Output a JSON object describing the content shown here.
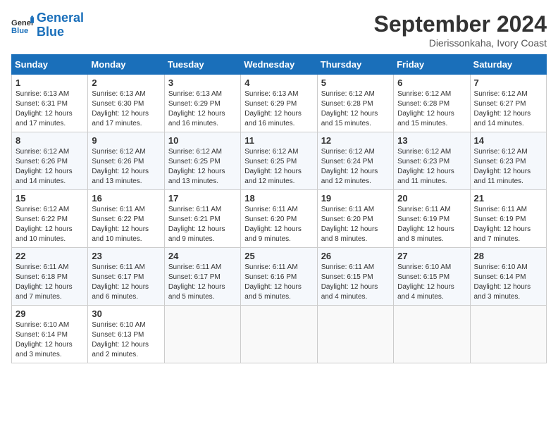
{
  "header": {
    "logo_line1": "General",
    "logo_line2": "Blue",
    "month": "September 2024",
    "location": "Dierissonkaha, Ivory Coast"
  },
  "days_of_week": [
    "Sunday",
    "Monday",
    "Tuesday",
    "Wednesday",
    "Thursday",
    "Friday",
    "Saturday"
  ],
  "weeks": [
    [
      {
        "day": "1",
        "info": "Sunrise: 6:13 AM\nSunset: 6:31 PM\nDaylight: 12 hours\nand 17 minutes."
      },
      {
        "day": "2",
        "info": "Sunrise: 6:13 AM\nSunset: 6:30 PM\nDaylight: 12 hours\nand 17 minutes."
      },
      {
        "day": "3",
        "info": "Sunrise: 6:13 AM\nSunset: 6:29 PM\nDaylight: 12 hours\nand 16 minutes."
      },
      {
        "day": "4",
        "info": "Sunrise: 6:13 AM\nSunset: 6:29 PM\nDaylight: 12 hours\nand 16 minutes."
      },
      {
        "day": "5",
        "info": "Sunrise: 6:12 AM\nSunset: 6:28 PM\nDaylight: 12 hours\nand 15 minutes."
      },
      {
        "day": "6",
        "info": "Sunrise: 6:12 AM\nSunset: 6:28 PM\nDaylight: 12 hours\nand 15 minutes."
      },
      {
        "day": "7",
        "info": "Sunrise: 6:12 AM\nSunset: 6:27 PM\nDaylight: 12 hours\nand 14 minutes."
      }
    ],
    [
      {
        "day": "8",
        "info": "Sunrise: 6:12 AM\nSunset: 6:26 PM\nDaylight: 12 hours\nand 14 minutes."
      },
      {
        "day": "9",
        "info": "Sunrise: 6:12 AM\nSunset: 6:26 PM\nDaylight: 12 hours\nand 13 minutes."
      },
      {
        "day": "10",
        "info": "Sunrise: 6:12 AM\nSunset: 6:25 PM\nDaylight: 12 hours\nand 13 minutes."
      },
      {
        "day": "11",
        "info": "Sunrise: 6:12 AM\nSunset: 6:25 PM\nDaylight: 12 hours\nand 12 minutes."
      },
      {
        "day": "12",
        "info": "Sunrise: 6:12 AM\nSunset: 6:24 PM\nDaylight: 12 hours\nand 12 minutes."
      },
      {
        "day": "13",
        "info": "Sunrise: 6:12 AM\nSunset: 6:23 PM\nDaylight: 12 hours\nand 11 minutes."
      },
      {
        "day": "14",
        "info": "Sunrise: 6:12 AM\nSunset: 6:23 PM\nDaylight: 12 hours\nand 11 minutes."
      }
    ],
    [
      {
        "day": "15",
        "info": "Sunrise: 6:12 AM\nSunset: 6:22 PM\nDaylight: 12 hours\nand 10 minutes."
      },
      {
        "day": "16",
        "info": "Sunrise: 6:11 AM\nSunset: 6:22 PM\nDaylight: 12 hours\nand 10 minutes."
      },
      {
        "day": "17",
        "info": "Sunrise: 6:11 AM\nSunset: 6:21 PM\nDaylight: 12 hours\nand 9 minutes."
      },
      {
        "day": "18",
        "info": "Sunrise: 6:11 AM\nSunset: 6:20 PM\nDaylight: 12 hours\nand 9 minutes."
      },
      {
        "day": "19",
        "info": "Sunrise: 6:11 AM\nSunset: 6:20 PM\nDaylight: 12 hours\nand 8 minutes."
      },
      {
        "day": "20",
        "info": "Sunrise: 6:11 AM\nSunset: 6:19 PM\nDaylight: 12 hours\nand 8 minutes."
      },
      {
        "day": "21",
        "info": "Sunrise: 6:11 AM\nSunset: 6:19 PM\nDaylight: 12 hours\nand 7 minutes."
      }
    ],
    [
      {
        "day": "22",
        "info": "Sunrise: 6:11 AM\nSunset: 6:18 PM\nDaylight: 12 hours\nand 7 minutes."
      },
      {
        "day": "23",
        "info": "Sunrise: 6:11 AM\nSunset: 6:17 PM\nDaylight: 12 hours\nand 6 minutes."
      },
      {
        "day": "24",
        "info": "Sunrise: 6:11 AM\nSunset: 6:17 PM\nDaylight: 12 hours\nand 5 minutes."
      },
      {
        "day": "25",
        "info": "Sunrise: 6:11 AM\nSunset: 6:16 PM\nDaylight: 12 hours\nand 5 minutes."
      },
      {
        "day": "26",
        "info": "Sunrise: 6:11 AM\nSunset: 6:15 PM\nDaylight: 12 hours\nand 4 minutes."
      },
      {
        "day": "27",
        "info": "Sunrise: 6:10 AM\nSunset: 6:15 PM\nDaylight: 12 hours\nand 4 minutes."
      },
      {
        "day": "28",
        "info": "Sunrise: 6:10 AM\nSunset: 6:14 PM\nDaylight: 12 hours\nand 3 minutes."
      }
    ],
    [
      {
        "day": "29",
        "info": "Sunrise: 6:10 AM\nSunset: 6:14 PM\nDaylight: 12 hours\nand 3 minutes."
      },
      {
        "day": "30",
        "info": "Sunrise: 6:10 AM\nSunset: 6:13 PM\nDaylight: 12 hours\nand 2 minutes."
      },
      null,
      null,
      null,
      null,
      null
    ]
  ]
}
